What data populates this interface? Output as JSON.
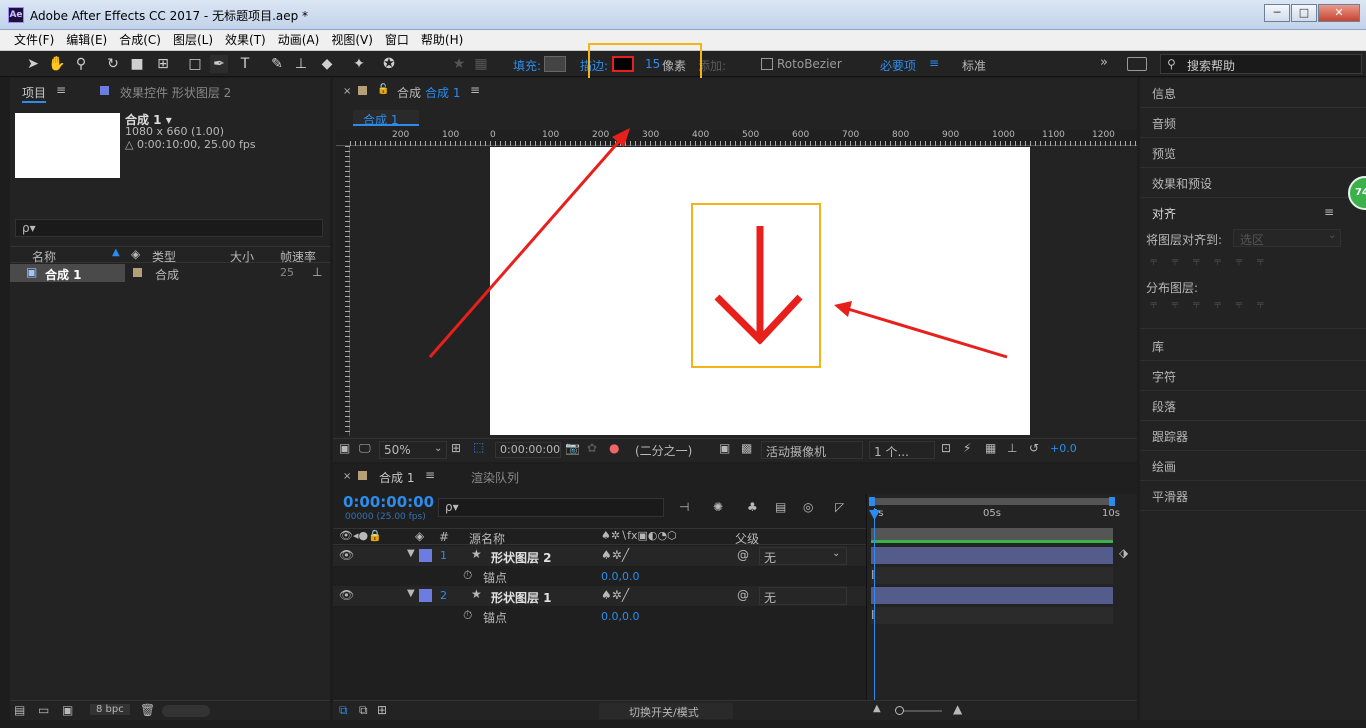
{
  "window": {
    "title": "Adobe After Effects CC 2017 - 无标题项目.aep *",
    "app_icon": "Ae",
    "buttons": [
      "─",
      "□",
      "✕"
    ]
  },
  "menu": [
    "文件(F)",
    "编辑(E)",
    "合成(C)",
    "图层(L)",
    "效果(T)",
    "动画(A)",
    "视图(V)",
    "窗口",
    "帮助(H)"
  ],
  "toolbar": {
    "fill_label": "填充:",
    "stroke_label": "描边:",
    "stroke_width": "15",
    "stroke_unit": "像素",
    "add_label": "添加:",
    "rotobezier": "RotoBezier",
    "essentials": "必要项",
    "standard": "标准",
    "search_placeholder": "搜索帮助"
  },
  "project": {
    "tab": "项目",
    "effects_tab": "效果控件 形状图层 2",
    "comp_name": "合成 1 ▾",
    "comp_size": "1080 x 660 (1.00)",
    "comp_duration": "△ 0:00:10:00, 25.00 fps",
    "search_placeholder": "ρ▾",
    "columns": [
      "名称",
      "类型",
      "大小",
      "帧速率"
    ],
    "rows": [
      {
        "name": "合成 1",
        "type": "合成",
        "size": "",
        "fps": "25"
      }
    ],
    "bpc": "8 bpc"
  },
  "comp": {
    "tab_prefix": "合成",
    "tab_name": "合成 1",
    "breadcrumb": "合成 1",
    "ruler": [
      "200",
      "100",
      "0",
      "100",
      "200",
      "300",
      "400",
      "500",
      "600",
      "700",
      "800",
      "900",
      "1000",
      "1100",
      "1200"
    ],
    "zoom": "50%",
    "timecode": "0:00:00:00",
    "resolution": "(二分之一)",
    "camera": "活动摄像机",
    "views": "1 个...",
    "exposure": "+0.0"
  },
  "timeline": {
    "tab": "合成 1",
    "render_queue": "渲染队列",
    "timecode": "0:00:00:00",
    "frame_info": "00000 (25.00 fps)",
    "col_source": "源名称",
    "col_parent": "父级",
    "time_marks": [
      "0s",
      "05s",
      "10s"
    ],
    "layers": [
      {
        "num": "1",
        "name": "形状图层 2",
        "prop": "锚点",
        "value": "0.0,0.0",
        "parent": "无"
      },
      {
        "num": "2",
        "name": "形状图层 1",
        "prop": "锚点",
        "value": "0.0,0.0",
        "parent": "无"
      }
    ],
    "toggle_label": "切换开关/模式"
  },
  "right_panels": [
    "信息",
    "音频",
    "预览",
    "效果和预设"
  ],
  "align": {
    "title": "对齐",
    "align_to_label": "将图层对齐到:",
    "align_to_value": "选区",
    "distribute_label": "分布图层:"
  },
  "right_panels2": [
    "库",
    "字符",
    "段落",
    "跟踪器",
    "绘画",
    "平滑器"
  ],
  "badge": "74",
  "colors": {
    "accent": "#2d8ceb",
    "annotation": "#f3b418",
    "arrow": "#e8201c",
    "layer_color": "#6c7ce0"
  }
}
